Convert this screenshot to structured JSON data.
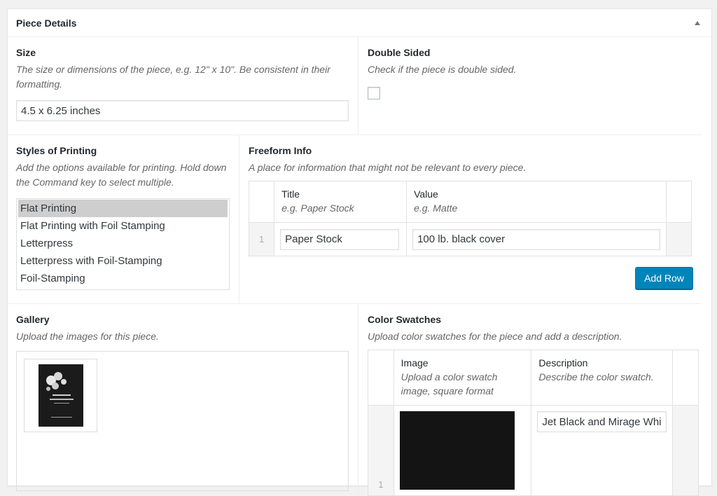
{
  "metabox": {
    "title": "Piece Details"
  },
  "size": {
    "label": "Size",
    "description": "The size or dimensions of the piece, e.g. 12\" x 10\". Be consistent in their formatting.",
    "value": "4.5 x 6.25 inches"
  },
  "double_sided": {
    "label": "Double Sided",
    "description": "Check if the piece is double sided.",
    "checked": false
  },
  "styles": {
    "label": "Styles of Printing",
    "description": "Add the options available for printing. Hold down the Command key to select multiple.",
    "options": [
      {
        "label": "Flat Printing",
        "selected": true
      },
      {
        "label": "Flat Printing with Foil Stamping",
        "selected": false
      },
      {
        "label": "Letterpress",
        "selected": false
      },
      {
        "label": "Letterpress with Foil-Stamping",
        "selected": false
      },
      {
        "label": "Foil-Stamping",
        "selected": false
      }
    ]
  },
  "freeform": {
    "label": "Freeform Info",
    "description": "A place for information that might not be relevant to every piece.",
    "col_title": "Title",
    "col_title_hint": "e.g. Paper Stock",
    "col_value": "Value",
    "col_value_hint": "e.g. Matte",
    "rows": [
      {
        "index": "1",
        "title": "Paper Stock",
        "value": "100 lb. black cover"
      }
    ],
    "add_row_label": "Add Row"
  },
  "gallery": {
    "label": "Gallery",
    "description": "Upload the images for this piece."
  },
  "swatches": {
    "label": "Color Swatches",
    "description": "Upload color swatches for the piece and add a description.",
    "col_image": "Image",
    "col_image_hint": "Upload a color swatch image, square format",
    "col_desc": "Description",
    "col_desc_hint": "Describe the color swatch.",
    "rows": [
      {
        "index": "1",
        "description": "Jet Black and Mirage White"
      }
    ]
  },
  "colors": {
    "primary_button": "#0085ba",
    "selected_option": "#cecece",
    "swatch_black": "#141414"
  }
}
